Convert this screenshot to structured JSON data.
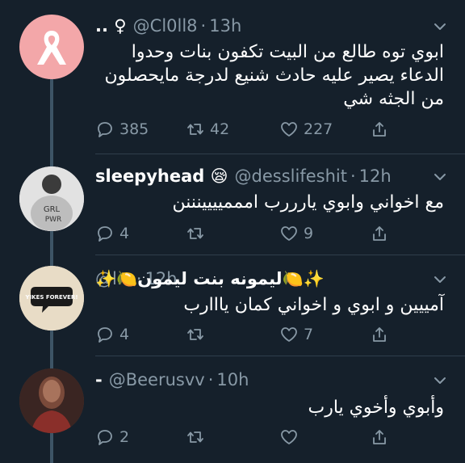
{
  "tweets": [
    {
      "display_name": ".. ♀",
      "handle": "@Cl0ll8",
      "time": "13h",
      "text_lines": [
        "ابوي توه طالع من البيت تكفون بنات وحدوا",
        "الدعاء يصير عليه حادث شنيع لدرجة مايحصلون",
        "من الجثه شي"
      ],
      "replies": "385",
      "retweets": "42",
      "likes": "227",
      "avatar": "pink-ribbon-icon",
      "avatar_color": "#f3a7a9"
    },
    {
      "display_name": "sleepyhead 😪",
      "handle": "@desslifeshit",
      "time": "12h",
      "text_lines": [
        "مع اخواني وابوي يارررب اممميييينننن"
      ],
      "replies": "4",
      "retweets": "",
      "likes": "9",
      "avatar": "girl-pwr-avatar",
      "avatar_color": "#d9d9d9"
    },
    {
      "display_name": "✨🍋ليمونه بنت ليمون🍋✨",
      "handle": "@l...",
      "time": "12h",
      "text_lines": [
        "آمييين و ابوي و اخواني كمان يااارب"
      ],
      "replies": "4",
      "retweets": "",
      "likes": "7",
      "avatar": "yikes-forever-avatar",
      "avatar_label": "YIKES FOREVER!",
      "avatar_color": "#e8dcc6"
    },
    {
      "display_name": "-",
      "handle": "@Beerusvv",
      "time": "10h",
      "text_lines": [
        "وأبوي وأخوي يارب"
      ],
      "replies": "2",
      "retweets": "",
      "likes": "",
      "avatar": "photo-avatar",
      "avatar_color": "#5a3a32"
    }
  ],
  "colors": {
    "background": "#15202b",
    "muted": "#8899a6",
    "divider": "#2f3e4c",
    "thread_line": "#3d5466"
  }
}
